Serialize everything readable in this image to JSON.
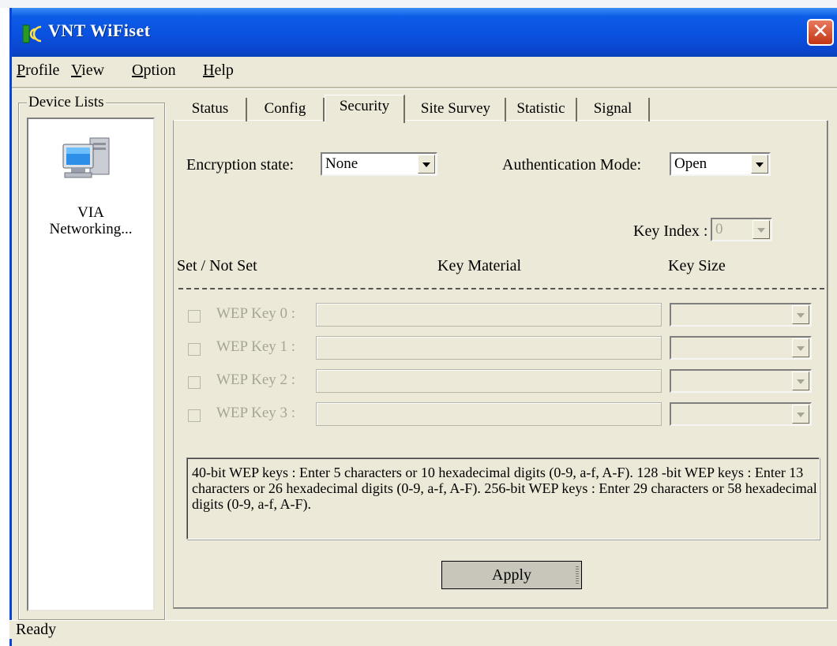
{
  "window": {
    "title": "VNT WiFiset",
    "close_glyph": "✕"
  },
  "menu": {
    "items": [
      {
        "underline": "P",
        "rest": "rofile"
      },
      {
        "underline": "V",
        "rest": "iew"
      },
      {
        "underline": "O",
        "rest": "ption"
      },
      {
        "underline": "H",
        "rest": "elp"
      }
    ]
  },
  "device_lists": {
    "legend": "Device Lists",
    "device_line1": "VIA",
    "device_line2": "Networking..."
  },
  "tabs": [
    "Status",
    "Config",
    "Security",
    "Site Survey",
    "Statistic",
    "Signal"
  ],
  "active_tab": "Security",
  "security": {
    "encryption_label": "Encryption state:",
    "encryption_value": "None",
    "auth_label": "Authentication Mode:",
    "auth_value": "Open",
    "key_index_label": "Key Index :",
    "key_index_value": "0",
    "col_set": "Set / Not Set",
    "col_material": "Key Material",
    "col_size": "Key Size",
    "wep_keys": [
      "WEP Key 0 :",
      "WEP Key 1 :",
      "WEP Key 2 :",
      "WEP Key 3 :"
    ],
    "info": " 40-bit WEP keys : Enter 5 characters or  10 hexadecimal digits (0-9, a-f, A-F). 128 -bit WEP keys : Enter 13 characters or  26 hexadecimal digits (0-9, a-f, A-F). 256-bit WEP keys : Enter 29 characters or  58 hexadecimal digits (0-9, a-f, A-F).",
    "apply_label": "Apply"
  },
  "status": {
    "text": "Ready"
  },
  "colors": {
    "titlebar": "#0a51df",
    "face": "#ece9d8",
    "close": "#c33614"
  }
}
